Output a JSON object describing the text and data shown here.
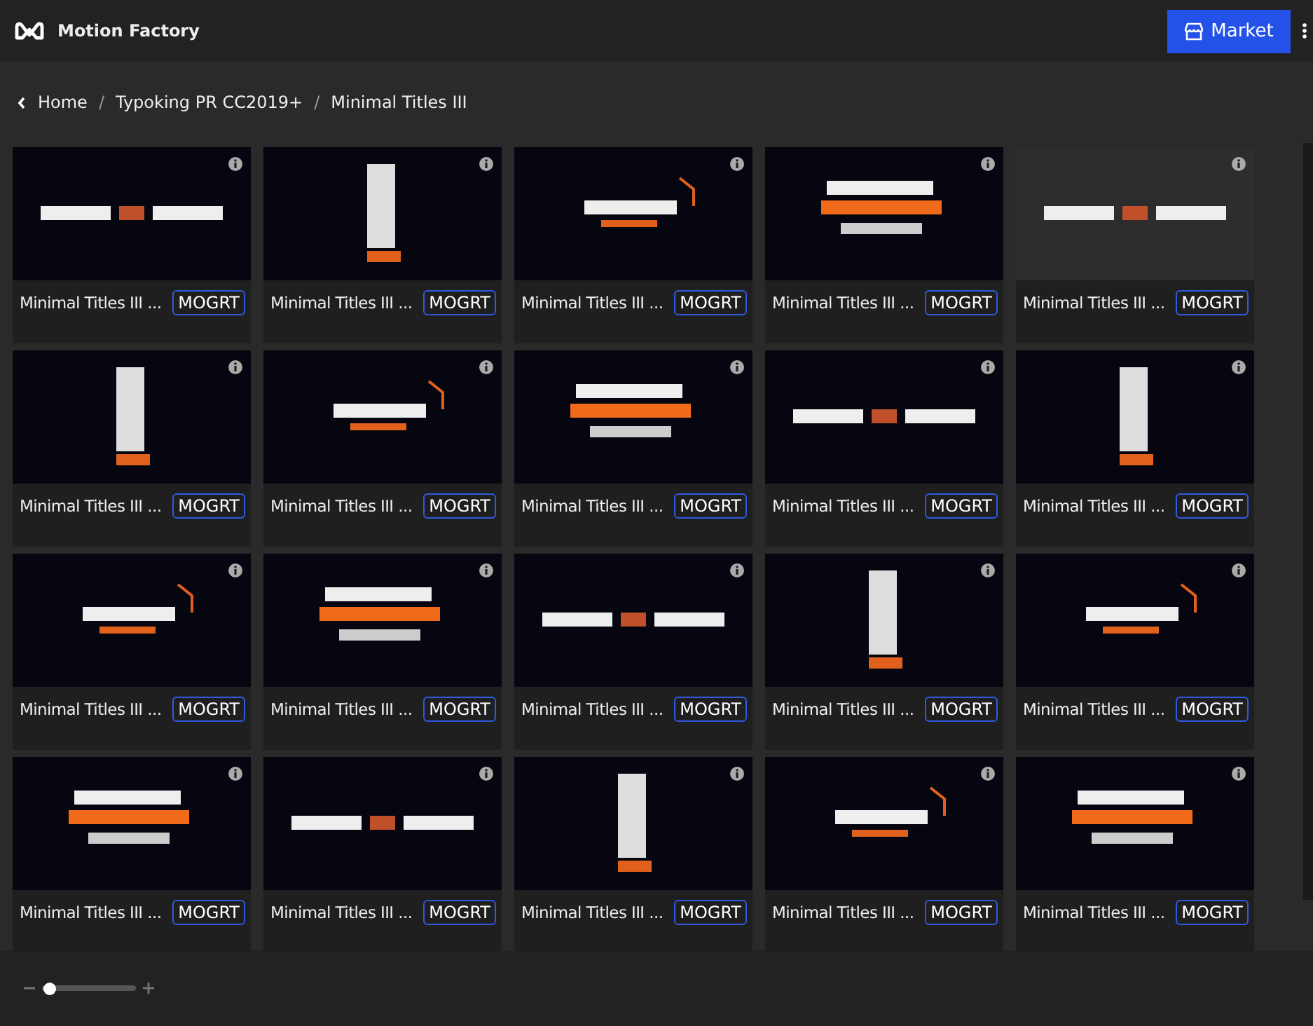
{
  "header": {
    "title": "Motion Factory",
    "market_button": "Market"
  },
  "breadcrumb": [
    {
      "kind": "link",
      "text": "Home"
    },
    {
      "kind": "separator",
      "text": "/"
    },
    {
      "kind": "link",
      "text": "Typoking PR CC2019+"
    },
    {
      "kind": "separator",
      "text": "/"
    },
    {
      "kind": "link",
      "text": "Minimal Titles III"
    }
  ],
  "cards": [
    {
      "title": "Minimal Titles III ...",
      "badge": "MOGRT"
    },
    {
      "title": "Minimal Titles III ...",
      "badge": "MOGRT"
    },
    {
      "title": "Minimal Titles III ...",
      "badge": "MOGRT"
    },
    {
      "title": "Minimal Titles III ...",
      "badge": "MOGRT"
    },
    {
      "title": "Minimal Titles III ...",
      "badge": "MOGRT"
    },
    {
      "title": "Minimal Titles III ...",
      "badge": "MOGRT"
    },
    {
      "title": "Minimal Titles III ...",
      "badge": "MOGRT"
    },
    {
      "title": "Minimal Titles III ...",
      "badge": "MOGRT"
    },
    {
      "title": "Minimal Titles III ...",
      "badge": "MOGRT"
    },
    {
      "title": "Minimal Titles III ...",
      "badge": "MOGRT"
    },
    {
      "title": "Minimal Titles III ...",
      "badge": "MOGRT"
    },
    {
      "title": "Minimal Titles III ...",
      "badge": "MOGRT"
    },
    {
      "title": "Minimal Titles III ...",
      "badge": "MOGRT"
    },
    {
      "title": "Minimal Titles III ...",
      "badge": "MOGRT"
    },
    {
      "title": "Minimal Titles III ...",
      "badge": "MOGRT"
    },
    {
      "title": "Minimal Titles III ...",
      "badge": "MOGRT"
    },
    {
      "title": "Minimal Titles III ...",
      "badge": "MOGRT"
    },
    {
      "title": "Minimal Titles III ...",
      "badge": "MOGRT"
    },
    {
      "title": "Minimal Titles III ...",
      "badge": "MOGRT"
    },
    {
      "title": "Minimal Titles III ...",
      "badge": "MOGRT"
    }
  ],
  "zoom_slider": {
    "level": 0.05
  }
}
